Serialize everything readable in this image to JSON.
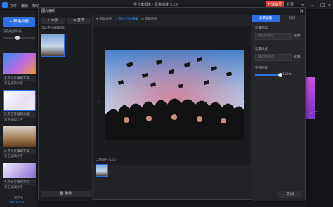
{
  "titlebar": {
    "menus": [
      "文件",
      "编辑",
      "帮助"
    ],
    "title": "毕业季相册 - 影像播放 3.1.0",
    "vip_badge": "开通会员",
    "login": "登录"
  },
  "sidebar": {
    "new_button": "新建相册",
    "section_label": "渲染播放时长",
    "thumbs": [
      {
        "label": "1  点击可编辑文案",
        "color": "#b06be0"
      },
      {
        "label": "2  点击可编辑文案",
        "color": "#e9e4f5"
      },
      {
        "label": "3  点击可编辑文案",
        "color": "#c9a46c"
      },
      {
        "label": "4  点击可编辑文案",
        "color": "#7b5cc9"
      }
    ],
    "sub_label": "双击编辑文字",
    "footer_label": "总时长",
    "footer_time": "00:04:53"
  },
  "dialog": {
    "title": "图片编辑",
    "left": {
      "add_label": "添加",
      "replace_label": "替换",
      "caption": "自动识别编辑图片",
      "delete_label": "删除"
    },
    "toolbar": [
      "移动图层",
      "图片自由编辑",
      "旋转图层"
    ],
    "strip_label": "当前图片(1/1)",
    "right": {
      "tabs": [
        "遮罩滤镜",
        "效果"
      ],
      "field1_label": "遮罩图案",
      "field1_placeholder": "请选择图案",
      "field1_btn": "选择",
      "field2_label": "遮罩样式",
      "field2_placeholder": "请选择样式",
      "field2_btn": "选择",
      "opacity_label": "不透明度",
      "opacity_value": "100%",
      "opacity_fraction": 1.0,
      "close_button": "关闭"
    }
  },
  "colors": {
    "accent": "#2e6fe6",
    "vip": "#e8463b"
  }
}
